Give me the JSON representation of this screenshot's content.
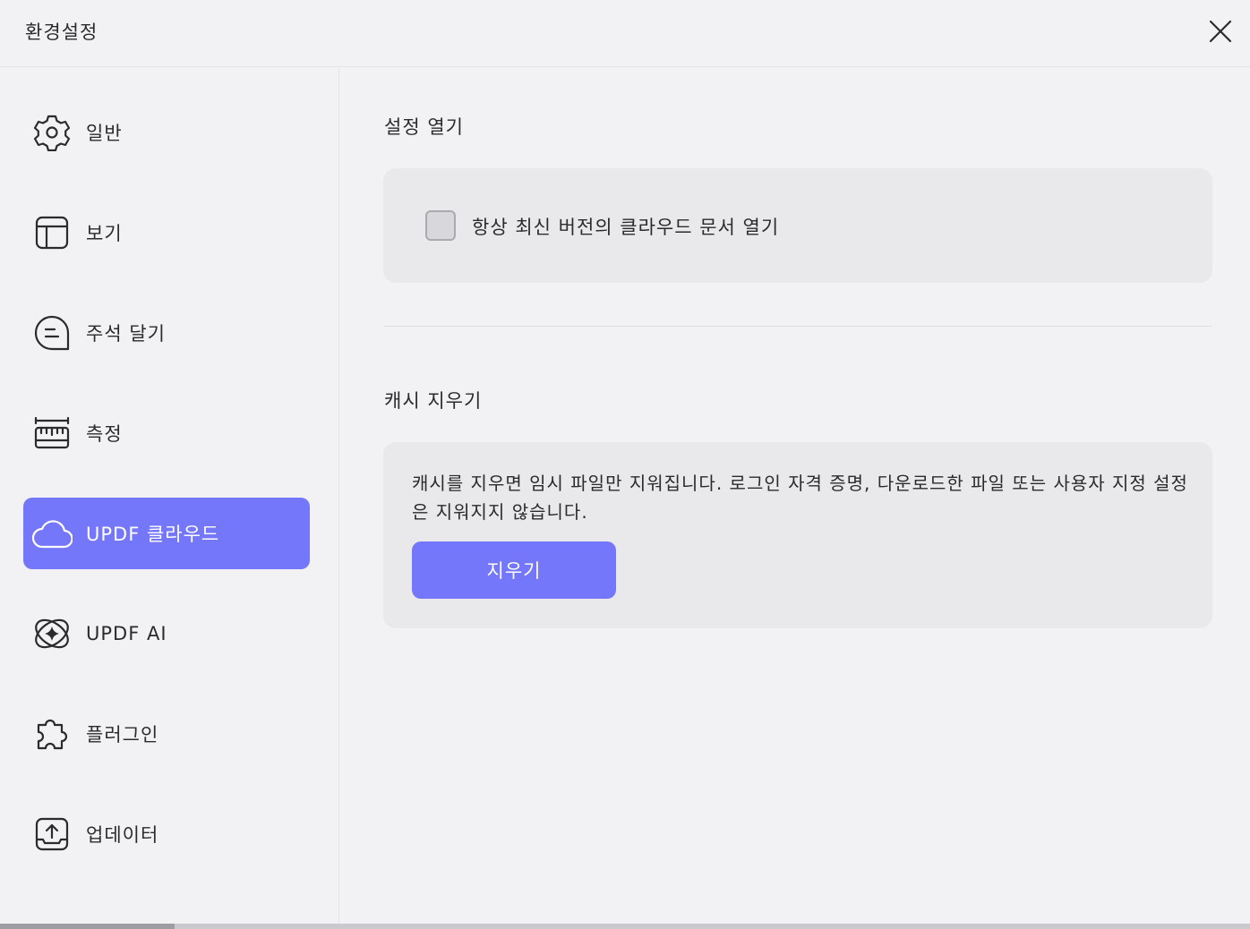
{
  "window": {
    "title": "환경설정",
    "close_icon": "close-icon"
  },
  "sidebar": {
    "items": [
      {
        "key": "general",
        "label": "일반",
        "icon": "gear-icon",
        "active": false
      },
      {
        "key": "view",
        "label": "보기",
        "icon": "layout-icon",
        "active": false
      },
      {
        "key": "comment",
        "label": "주석 달기",
        "icon": "comment-icon",
        "active": false
      },
      {
        "key": "measure",
        "label": "측정",
        "icon": "ruler-icon",
        "active": false
      },
      {
        "key": "cloud",
        "label": "UPDF 클라우드",
        "icon": "cloud-icon",
        "active": true
      },
      {
        "key": "ai",
        "label": "UPDF AI",
        "icon": "ai-sparkle-icon",
        "active": false
      },
      {
        "key": "plugin",
        "label": "플러그인",
        "icon": "puzzle-icon",
        "active": false
      },
      {
        "key": "updater",
        "label": "업데이터",
        "icon": "upload-icon",
        "active": false
      }
    ]
  },
  "main": {
    "open_settings": {
      "title": "설정 열기",
      "checkbox_label": "항상 최신 버전의 클라우드 문서 열기",
      "checked": false
    },
    "clear_cache": {
      "title": "캐시 지우기",
      "description": "캐시를 지우면 임시 파일만 지워집니다. 로그인 자격 증명, 다운로드한 파일 또는 사용자 지정 설정은 지워지지 않습니다.",
      "button_label": "지우기"
    }
  },
  "colors": {
    "accent": "#7577fb",
    "background": "#f2f2f4",
    "card": "#e9e9ec"
  }
}
